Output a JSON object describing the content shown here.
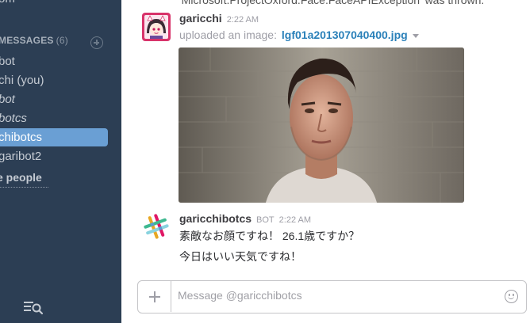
{
  "sidebar": {
    "top_partial": "om",
    "section_title": "MESSAGES",
    "section_count": "(6)",
    "items": [
      {
        "label": "bot",
        "italic": false,
        "active": false
      },
      {
        "label": "chi (you)",
        "italic": false,
        "active": false
      },
      {
        "label": "bot",
        "italic": true,
        "active": false
      },
      {
        "label": "botcs",
        "italic": true,
        "active": false
      },
      {
        "label": "chibotcs",
        "italic": false,
        "active": true
      },
      {
        "label": "garibot2",
        "italic": false,
        "active": false
      }
    ],
    "more_people": "e people"
  },
  "messages": {
    "overflow_text": "'Microsoft.ProjectOxford.Face.FaceAPIException' was thrown.",
    "msg1": {
      "author": "garicchi",
      "time": "2:22 AM",
      "action": "uploaded an image:",
      "file_name": "lgf01a201307040400.jpg"
    },
    "msg2": {
      "author": "garicchibotcs",
      "bot_tag": "BOT",
      "time": "2:22 AM",
      "line1": "素敵なお顔ですね！ 26.1歳ですか？",
      "line2": "今日はいい天気ですね！"
    }
  },
  "composer": {
    "placeholder": "Message @garicchibotcs"
  },
  "colors": {
    "sidebar_bg": "#2c3e54",
    "active_item": "#6a9fd4",
    "link": "#2a80b9"
  }
}
